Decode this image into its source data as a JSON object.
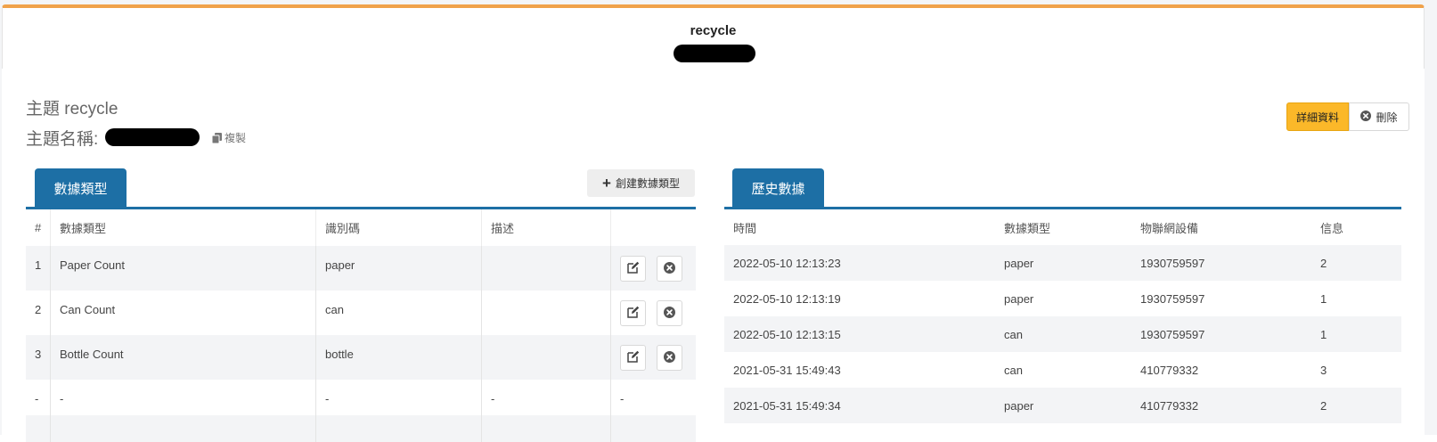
{
  "header": {
    "title": "recycle"
  },
  "topic": {
    "title": "主題 recycle",
    "name_label": "主題名稱:",
    "copy_label": "複製"
  },
  "actions": {
    "details_label": "詳細資料",
    "delete_label": "刪除"
  },
  "data_types": {
    "tab_label": "數據類型",
    "create_label": "創建數據類型",
    "columns": [
      "#",
      "數據類型",
      "識別碼",
      "描述"
    ],
    "rows": [
      {
        "idx": "1",
        "type": "Paper Count",
        "code": "paper",
        "desc": ""
      },
      {
        "idx": "2",
        "type": "Can Count",
        "code": "can",
        "desc": ""
      },
      {
        "idx": "3",
        "type": "Bottle Count",
        "code": "bottle",
        "desc": ""
      }
    ],
    "empty_row": {
      "idx": "-",
      "type": "-",
      "code": "-",
      "desc": "-",
      "act": "-"
    }
  },
  "history": {
    "tab_label": "歷史數據",
    "columns": [
      "時間",
      "數據類型",
      "物聯網設備",
      "信息"
    ],
    "rows": [
      {
        "time": "2022-05-10 12:13:23",
        "type": "paper",
        "device": "1930759597",
        "info": "2"
      },
      {
        "time": "2022-05-10 12:13:19",
        "type": "paper",
        "device": "1930759597",
        "info": "1"
      },
      {
        "time": "2022-05-10 12:13:15",
        "type": "can",
        "device": "1930759597",
        "info": "1"
      },
      {
        "time": "2021-05-31 15:49:43",
        "type": "can",
        "device": "410779332",
        "info": "3"
      },
      {
        "time": "2021-05-31 15:49:34",
        "type": "paper",
        "device": "410779332",
        "info": "2"
      }
    ]
  },
  "colors": {
    "accent_top": "#f0a24a",
    "tab_blue": "#1d6fa5",
    "details_button": "#fbb829"
  },
  "icons": {
    "copy": "copy-icon",
    "delete": "times-circle-icon",
    "create": "plus-icon",
    "edit": "edit-icon",
    "remove": "times-circle-icon"
  }
}
